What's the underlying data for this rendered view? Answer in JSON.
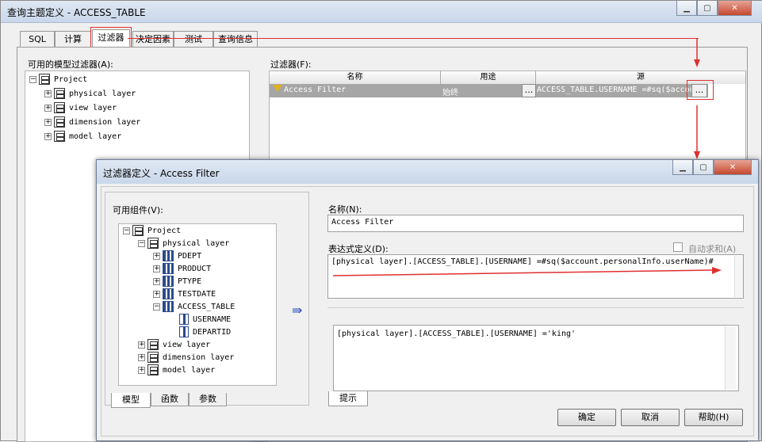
{
  "outer": {
    "title": "查询主题定义 - ACCESS_TABLE",
    "tabs": [
      "SQL",
      "计算",
      "过滤器",
      "决定因素",
      "测试",
      "查询信息"
    ],
    "available_label": "可用的模型过滤器(A):",
    "filters_label": "过滤器(F):",
    "table_headers": [
      "名称",
      "用途",
      "源"
    ],
    "filter_row": {
      "name": "Access Filter",
      "usage": "始终",
      "usage_btn": "...",
      "source": "ACCESS_TABLE.USERNAME =#sq($accou",
      "source_btn": "..."
    },
    "tree": [
      {
        "label": "Project"
      },
      {
        "label": "physical layer"
      },
      {
        "label": "view layer"
      },
      {
        "label": "dimension layer"
      },
      {
        "label": "model layer"
      }
    ]
  },
  "dialog": {
    "title": "过滤器定义 - Access Filter",
    "components_label": "可用组件(V):",
    "tree": {
      "project": "Project",
      "physical": "physical layer",
      "tables": [
        "PDEPT",
        "PRODUCT",
        "PTYPE",
        "TESTDATE",
        "ACCESS_TABLE"
      ],
      "columns": [
        "USERNAME",
        "DEPARTID"
      ],
      "others": [
        "view layer",
        "dimension layer",
        "model layer"
      ]
    },
    "left_tabs": [
      "模型",
      "函数",
      "参数"
    ],
    "name_label": "名称(N):",
    "name_value": "Access Filter",
    "expr_label": "表达式定义(D):",
    "auto_sum_label": "自动求和(A)",
    "expr_value": "[physical layer].[ACCESS_TABLE].[USERNAME]  =#sq($account.personalInfo.userName)#",
    "hint_value": "[physical layer].[ACCESS_TABLE].[USERNAME]  ='king'",
    "hint_tab": "提示",
    "insert_arrow": "⇛",
    "buttons": {
      "ok": "确定",
      "cancel": "取消",
      "help": "帮助(H)"
    }
  },
  "colors": {
    "accent_red": "#e03030",
    "selected_row": "#a6a6a6"
  }
}
